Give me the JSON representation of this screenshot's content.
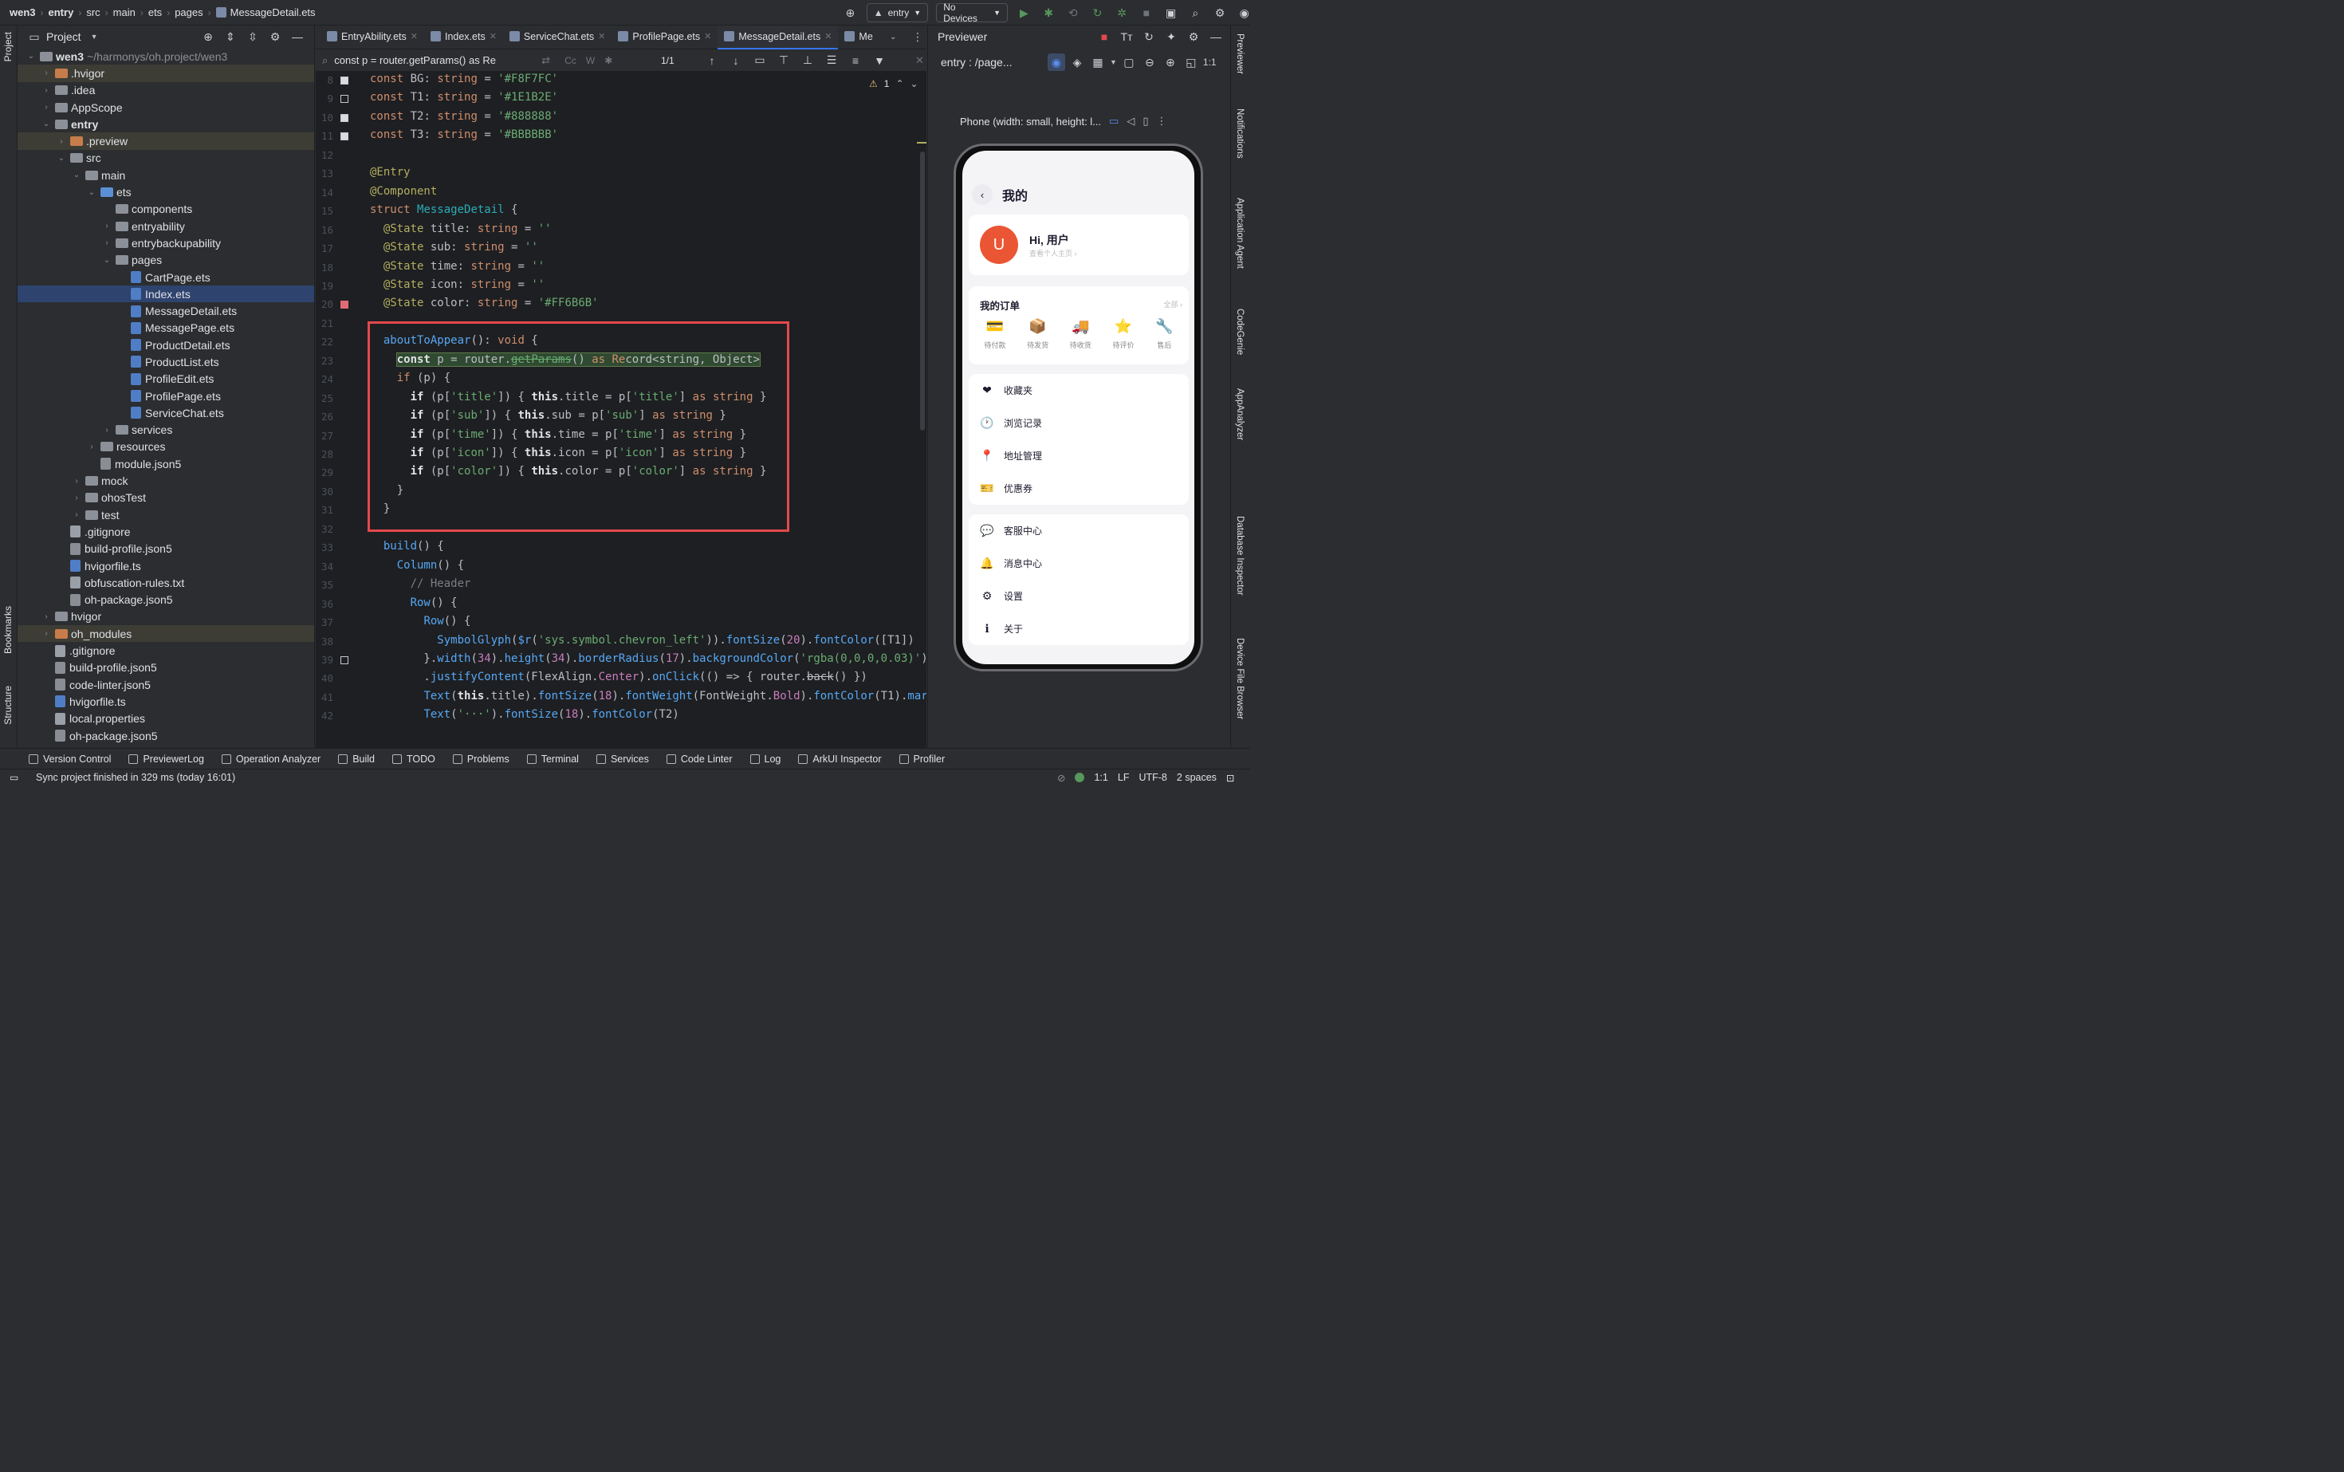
{
  "breadcrumb": [
    "wen3",
    "entry",
    "src",
    "main",
    "ets",
    "pages",
    "MessageDetail.ets"
  ],
  "run_config": {
    "module": "entry",
    "devices": "No Devices"
  },
  "left_strip": {
    "project": "Project",
    "bookmarks": "Bookmarks",
    "structure": "Structure"
  },
  "project_panel": {
    "title": "Project",
    "tree": [
      {
        "label": "wen3",
        "extra": "~/harmonys/oh.project/wen3",
        "indent": 0,
        "type": "folder",
        "open": true
      },
      {
        "label": ".hvigor",
        "indent": 1,
        "type": "folder-orange",
        "open": false
      },
      {
        "label": ".idea",
        "indent": 1,
        "type": "folder",
        "open": false
      },
      {
        "label": "AppScope",
        "indent": 1,
        "type": "folder",
        "open": false
      },
      {
        "label": "entry",
        "indent": 1,
        "type": "folder",
        "open": true
      },
      {
        "label": ".preview",
        "indent": 2,
        "type": "folder-orange",
        "open": false
      },
      {
        "label": "src",
        "indent": 2,
        "type": "folder",
        "open": true
      },
      {
        "label": "main",
        "indent": 3,
        "type": "folder",
        "open": true
      },
      {
        "label": "ets",
        "indent": 4,
        "type": "folder-blue",
        "open": true
      },
      {
        "label": "components",
        "indent": 5,
        "type": "folder",
        "open": null
      },
      {
        "label": "entryability",
        "indent": 5,
        "type": "folder",
        "open": false
      },
      {
        "label": "entrybackupability",
        "indent": 5,
        "type": "folder",
        "open": false
      },
      {
        "label": "pages",
        "indent": 5,
        "type": "folder",
        "open": true
      },
      {
        "label": "CartPage.ets",
        "indent": 6,
        "type": "file-ets"
      },
      {
        "label": "Index.ets",
        "indent": 6,
        "type": "file-ets"
      },
      {
        "label": "MessageDetail.ets",
        "indent": 6,
        "type": "file-ets"
      },
      {
        "label": "MessagePage.ets",
        "indent": 6,
        "type": "file-ets"
      },
      {
        "label": "ProductDetail.ets",
        "indent": 6,
        "type": "file-ets"
      },
      {
        "label": "ProductList.ets",
        "indent": 6,
        "type": "file-ets"
      },
      {
        "label": "ProfileEdit.ets",
        "indent": 6,
        "type": "file-ets"
      },
      {
        "label": "ProfilePage.ets",
        "indent": 6,
        "type": "file-ets"
      },
      {
        "label": "ServiceChat.ets",
        "indent": 6,
        "type": "file-ets"
      },
      {
        "label": "services",
        "indent": 5,
        "type": "folder",
        "open": false
      },
      {
        "label": "resources",
        "indent": 4,
        "type": "folder",
        "open": false
      },
      {
        "label": "module.json5",
        "indent": 4,
        "type": "file-json"
      },
      {
        "label": "mock",
        "indent": 3,
        "type": "folder",
        "open": false
      },
      {
        "label": "ohosTest",
        "indent": 3,
        "type": "folder",
        "open": false
      },
      {
        "label": "test",
        "indent": 3,
        "type": "folder",
        "open": false
      },
      {
        "label": ".gitignore",
        "indent": 2,
        "type": "file-txt"
      },
      {
        "label": "build-profile.json5",
        "indent": 2,
        "type": "file-json"
      },
      {
        "label": "hvigorfile.ts",
        "indent": 2,
        "type": "file-ts"
      },
      {
        "label": "obfuscation-rules.txt",
        "indent": 2,
        "type": "file-txt"
      },
      {
        "label": "oh-package.json5",
        "indent": 2,
        "type": "file-json"
      },
      {
        "label": "hvigor",
        "indent": 1,
        "type": "folder",
        "open": false
      },
      {
        "label": "oh_modules",
        "indent": 1,
        "type": "folder-orange",
        "open": false
      },
      {
        "label": ".gitignore",
        "indent": 1,
        "type": "file-txt"
      },
      {
        "label": "build-profile.json5",
        "indent": 1,
        "type": "file-json"
      },
      {
        "label": "code-linter.json5",
        "indent": 1,
        "type": "file-json"
      },
      {
        "label": "hvigorfile.ts",
        "indent": 1,
        "type": "file-ts"
      },
      {
        "label": "local.properties",
        "indent": 1,
        "type": "file-txt"
      },
      {
        "label": "oh-package.json5",
        "indent": 1,
        "type": "file-json"
      }
    ]
  },
  "editor_tabs": [
    "EntryAbility.ets",
    "Index.ets",
    "ServiceChat.ets",
    "ProfilePage.ets",
    "MessageDetail.ets",
    "Me"
  ],
  "find_bar": {
    "query": "const p = router.getParams() as Re",
    "count": "1/1"
  },
  "inspection": {
    "warnings": "1"
  },
  "code_lines": [
    {
      "n": "8",
      "html": "<span class='kw'>const</span> BG: <span class='kw'>string</span> = <span class='st'>'#F8F7FC'</span>"
    },
    {
      "n": "9",
      "html": "<span class='kw'>const</span> T1: <span class='kw'>string</span> = <span class='st'>'#1E1B2E'</span>"
    },
    {
      "n": "10",
      "html": "<span class='kw'>const</span> T2: <span class='kw'>string</span> = <span class='st'>'#888888'</span>"
    },
    {
      "n": "11",
      "html": "<span class='kw'>const</span> T3: <span class='kw'>string</span> = <span class='st'>'#BBBBBB'</span>"
    },
    {
      "n": "12",
      "html": ""
    },
    {
      "n": "13",
      "html": "<span class='an'>@Entry</span>"
    },
    {
      "n": "14",
      "html": "<span class='an'>@Component</span>"
    },
    {
      "n": "15",
      "html": "<span class='kw'>struct</span> <span style='color:#2aacb8'>MessageDetail</span> {"
    },
    {
      "n": "16",
      "html": "  <span class='an'>@State</span> title: <span class='kw'>string</span> = <span class='st'>''</span>"
    },
    {
      "n": "17",
      "html": "  <span class='an'>@State</span> sub: <span class='kw'>string</span> = <span class='st'>''</span>"
    },
    {
      "n": "18",
      "html": "  <span class='an'>@State</span> time: <span class='kw'>string</span> = <span class='st'>''</span>"
    },
    {
      "n": "19",
      "html": "  <span class='an'>@State</span> icon: <span class='kw'>string</span> = <span class='st'>''</span>"
    },
    {
      "n": "20",
      "html": "  <span class='an'>@State</span> color: <span class='kw'>string</span> = <span class='st'>'#FF6B6B'</span>"
    },
    {
      "n": "21",
      "html": ""
    },
    {
      "n": "22",
      "html": "  <span class='fn'>aboutToAppear</span>(): <span class='kw'>void</span> {"
    },
    {
      "n": "23",
      "html": "    <span style='background:#2f4a31;outline:1px solid #5d7a4b'><span class='kwb'>const</span> p = router.<span style='text-decoration:line-through' class='st'>getParams</span>() <span class='kw'>as</span> <span class='kw'>Re</span>cord&lt;string, Object&gt;</span>"
    },
    {
      "n": "24",
      "html": "    <span class='kw'>if</span> (p) {"
    },
    {
      "n": "25",
      "html": "      <span class='kwb'>if</span> (p[<span class='st'>'title'</span>]) { <span class='kwb'>this</span>.title = p[<span class='st'>'title'</span>] <span class='kw'>as</span> <span class='kw'>string</span> }"
    },
    {
      "n": "26",
      "html": "      <span class='kwb'>if</span> (p[<span class='st'>'sub'</span>]) { <span class='kwb'>this</span>.sub = p[<span class='st'>'sub'</span>] <span class='kw'>as</span> <span class='kw'>string</span> }"
    },
    {
      "n": "27",
      "html": "      <span class='kwb'>if</span> (p[<span class='st'>'time'</span>]) { <span class='kwb'>this</span>.time = p[<span class='st'>'time'</span>] <span class='kw'>as</span> <span class='kw'>string</span> }"
    },
    {
      "n": "28",
      "html": "      <span class='kwb'>if</span> (p[<span class='st'>'icon'</span>]) { <span class='kwb'>this</span>.icon = p[<span class='st'>'icon'</span>] <span class='kw'>as</span> <span class='kw'>string</span> }"
    },
    {
      "n": "29",
      "html": "      <span class='kwb'>if</span> (p[<span class='st'>'color'</span>]) { <span class='kwb'>this</span>.color = p[<span class='st'>'color'</span>] <span class='kw'>as</span> <span class='kw'>string</span> }"
    },
    {
      "n": "30",
      "html": "    }"
    },
    {
      "n": "31",
      "html": "  }"
    },
    {
      "n": "32",
      "html": ""
    },
    {
      "n": "33",
      "html": "  <span class='fn'>build</span>() {"
    },
    {
      "n": "34",
      "html": "    <span class='fn'>Column</span>() {"
    },
    {
      "n": "35",
      "html": "      <span class='cm'>// Header</span>"
    },
    {
      "n": "36",
      "html": "      <span class='fn'>Row</span>() {"
    },
    {
      "n": "37",
      "html": "        <span class='fn'>Row</span>() {"
    },
    {
      "n": "38",
      "html": "          <span class='fn'>SymbolGlyph</span>(<span class='fn'>$r</span>(<span class='st'>'sys.symbol.chevron_left'</span>)).<span class='fn'>fontSize</span>(<span class='pp'>20</span>).<span class='fn'>fontColor</span>([T1])"
    },
    {
      "n": "39",
      "html": "        }.<span class='fn'>width</span>(<span class='pp'>34</span>).<span class='fn'>height</span>(<span class='pp'>34</span>).<span class='fn'>borderRadius</span>(<span class='pp'>17</span>).<span class='fn'>backgroundColor</span>(<span class='st'>'rgba(0,0,0,0.03)'</span>)"
    },
    {
      "n": "40",
      "html": "        .<span class='fn'>justifyContent</span>(FlexAlign.<span class='pp'>Center</span>).<span class='fn'>onClick</span>(() => { router.<span style='text-decoration:line-through'>back</span>() })"
    },
    {
      "n": "41",
      "html": "        <span class='fn'>Text</span>(<span class='kwb'>this</span>.title).<span class='fn'>fontSize</span>(<span class='pp'>18</span>).<span class='fn'>fontWeight</span>(FontWeight.<span class='pp'>Bold</span>).<span class='fn'>fontColor</span>(T1).<span class='fn'>marg</span>"
    },
    {
      "n": "42",
      "html": "        <span class='fn'>Text</span>(<span class='st'>'···'</span>).<span class='fn'>fontSize</span>(<span class='pp'>18</span>).<span class='fn'>fontColor</span>(T2)"
    }
  ],
  "previewer": {
    "title": "Previewer",
    "route": "entry : /page...",
    "device": "Phone (width: small, height: l...",
    "zoom": "1:1"
  },
  "phone_app": {
    "header_title": "我的",
    "user_name": "Hi, 用户",
    "user_sub": "查看个人主页 ›",
    "avatar_letter": "U",
    "orders_title": "我的订单",
    "orders_all": "全部 ›",
    "orders": [
      {
        "label": "待付款",
        "icon": "💳"
      },
      {
        "label": "待发货",
        "icon": "📦"
      },
      {
        "label": "待收货",
        "icon": "🚚"
      },
      {
        "label": "待评价",
        "icon": "⭐"
      },
      {
        "label": "售后",
        "icon": "🔧"
      }
    ],
    "menu_group1": [
      {
        "label": "收藏夹",
        "icon": "❤"
      },
      {
        "label": "浏览记录",
        "icon": "🕐"
      },
      {
        "label": "地址管理",
        "icon": "📍"
      },
      {
        "label": "优惠券",
        "icon": "🎫"
      }
    ],
    "menu_group2": [
      {
        "label": "客服中心",
        "icon": "💬"
      },
      {
        "label": "消息中心",
        "icon": "🔔"
      },
      {
        "label": "设置",
        "icon": "⚙"
      },
      {
        "label": "关于",
        "icon": "ℹ"
      }
    ]
  },
  "right_strip": [
    "Previewer",
    "Notifications",
    "Application Agent",
    "CodeGenie",
    "AppAnalyzer",
    "Database Inspector",
    "Device File Browser"
  ],
  "bottom_tools": [
    "Version Control",
    "PreviewerLog",
    "Operation Analyzer",
    "Build",
    "TODO",
    "Problems",
    "Terminal",
    "Services",
    "Code Linter",
    "Log",
    "ArkUI Inspector",
    "Profiler"
  ],
  "status_bar": {
    "message": "Sync project finished in 329 ms (today 16:01)",
    "position": "1:1",
    "line_sep": "LF",
    "encoding": "UTF-8",
    "indent": "2 spaces"
  }
}
